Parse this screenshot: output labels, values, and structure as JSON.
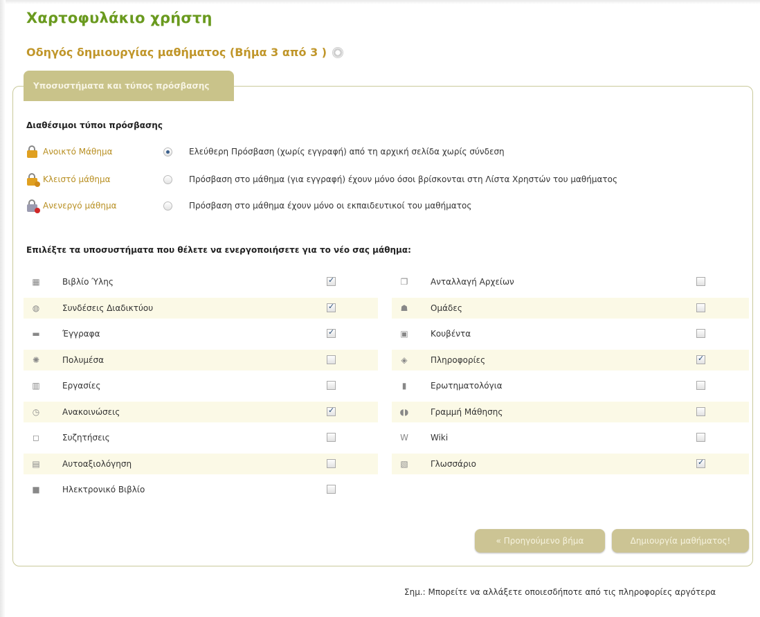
{
  "page": {
    "title": "Χαρτοφυλάκιο χρήστη",
    "subtitle": "Οδηγός δημιουργίας μαθήματος (Βήμα 3 από 3 )"
  },
  "panel": {
    "tab_label": "Υποσυστήματα και τύπος πρόσβασης"
  },
  "access": {
    "heading": "Διαθέσιμοι τύποι πρόσβασης",
    "options": [
      {
        "label": "Ανοικτό Μάθημα",
        "description": "Ελεύθερη Πρόσβαση (χωρίς εγγραφή) από τη αρχική σελίδα χωρίς σύνδεση",
        "selected": true,
        "icon": "open-lock-icon",
        "color": "#e0a020"
      },
      {
        "label": "Κλειστό μάθημα",
        "description": "Πρόσβαση στο μάθημα (για εγγραφή) έχουν μόνο όσοι βρίσκονται στη Λίστα Χρηστών του μαθήματος",
        "selected": false,
        "icon": "closed-lock-icon",
        "color": "#e0a020"
      },
      {
        "label": "Ανενεργό μάθημα",
        "description": "Πρόσβαση στο μάθημα έχουν μόνο οι εκπαιδευτικοί του μαθήματος",
        "selected": false,
        "icon": "inactive-lock-icon",
        "color": "#cc3333"
      }
    ]
  },
  "modules": {
    "heading": "Επιλέξτε τα υποσυστήματα που θέλετε να ενεργοποιήσετε για το νέο σας μάθημα:",
    "left": [
      {
        "label": "Βιβλίο Ύλης",
        "checked": true,
        "icon": "calendar-icon",
        "glyph": "▦"
      },
      {
        "label": "Συνδέσεις Διαδικτύου",
        "checked": true,
        "icon": "globe-icon",
        "glyph": "◍"
      },
      {
        "label": "Έγγραφα",
        "checked": true,
        "icon": "folder-icon",
        "glyph": "▬"
      },
      {
        "label": "Πολυμέσα",
        "checked": false,
        "icon": "film-reel-icon",
        "glyph": "✺"
      },
      {
        "label": "Εργασίες",
        "checked": false,
        "icon": "book-icon",
        "glyph": "▥"
      },
      {
        "label": "Ανακοινώσεις",
        "checked": true,
        "icon": "clock-icon",
        "glyph": "◷"
      },
      {
        "label": "Συζητήσεις",
        "checked": false,
        "icon": "speech-bubble-icon",
        "glyph": "◻"
      },
      {
        "label": "Αυτοαξιολόγηση",
        "checked": false,
        "icon": "quiz-icon",
        "glyph": "▤"
      },
      {
        "label": "Ηλεκτρονικό Βιβλίο",
        "checked": false,
        "icon": "ebook-icon",
        "glyph": "■"
      }
    ],
    "right": [
      {
        "label": "Ανταλλαγή Αρχείων",
        "checked": false,
        "icon": "file-exchange-icon",
        "glyph": "❐"
      },
      {
        "label": "Ομάδες",
        "checked": false,
        "icon": "group-icon",
        "glyph": "☗"
      },
      {
        "label": "Κουβέντα",
        "checked": false,
        "icon": "chat-icon",
        "glyph": "▣"
      },
      {
        "label": "Πληροφορίες",
        "checked": true,
        "icon": "tag-icon",
        "glyph": "◈"
      },
      {
        "label": "Ερωτηματολόγια",
        "checked": false,
        "icon": "questionnaire-icon",
        "glyph": "▮"
      },
      {
        "label": "Γραμμή Μάθησης",
        "checked": false,
        "icon": "footprints-icon",
        "glyph": "◖◗"
      },
      {
        "label": "Wiki",
        "checked": false,
        "icon": "wiki-icon",
        "glyph": "W"
      },
      {
        "label": "Γλωσσάριο",
        "checked": true,
        "icon": "glossary-icon",
        "glyph": "▧"
      }
    ]
  },
  "buttons": {
    "prev": "« Προηγούμενο βήμα",
    "create": "Δημιουργία μαθήματος!"
  },
  "footnote": "Σημ.: Μπορείτε να αλλάξετε οποιεσδήποτε από τις πληροφορίες αργότερα"
}
